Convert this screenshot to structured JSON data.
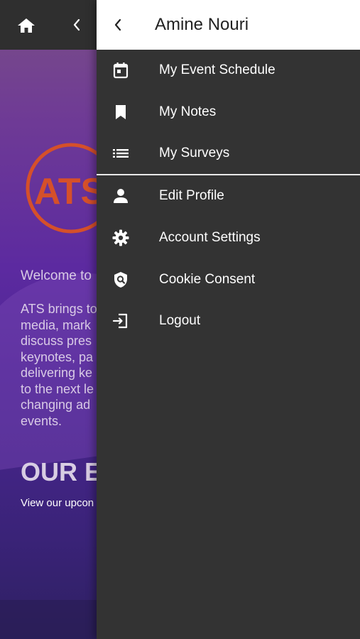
{
  "background_page": {
    "home_icon": "home-icon",
    "back_icon": "chevron-left-icon",
    "logo_text": "ATS",
    "welcome_text": "Welcome to",
    "intro_lines": "ATS brings to\nmedia, mark\ndiscuss pres\nkeynotes, pa\ndelivering ke\nto the next le\nchanging ad\nevents.",
    "events_heading": "OUR E",
    "events_subtext": "View our upcon",
    "colors": {
      "gradient_top": "#7a4f86",
      "gradient_bottom": "#2e2062",
      "logo_orange": "#d5502a"
    }
  },
  "drawer": {
    "back_icon": "chevron-left-icon",
    "user_name": "Amine Nouri",
    "menu_items": [
      {
        "label": "My Event Schedule",
        "icon": "calendar-icon"
      },
      {
        "label": "My Notes",
        "icon": "bookmark-icon"
      },
      {
        "label": "My Surveys",
        "icon": "list-icon"
      },
      {
        "label": "Edit Profile",
        "icon": "person-icon"
      },
      {
        "label": "Account Settings",
        "icon": "gear-icon"
      },
      {
        "label": "Cookie Consent",
        "icon": "shield-search-icon"
      },
      {
        "label": "Logout",
        "icon": "logout-icon"
      }
    ],
    "colors": {
      "header_bg": "#ffffff",
      "drawer_bg": "#333333",
      "text": "#ffffff"
    }
  }
}
